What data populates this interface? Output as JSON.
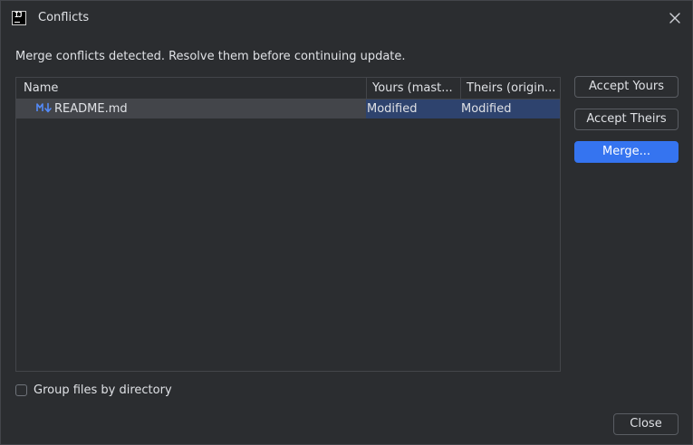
{
  "window": {
    "title": "Conflicts"
  },
  "message": "Merge conflicts detected. Resolve them before continuing update.",
  "table": {
    "columns": [
      "Name",
      "Yours (mast...",
      "Theirs (origin..."
    ],
    "rows": [
      {
        "icon": "markdown-file-icon",
        "name": "README.md",
        "yours": "Modified",
        "theirs": "Modified",
        "selected": true
      }
    ]
  },
  "actions": {
    "accept_yours": "Accept Yours",
    "accept_theirs": "Accept Theirs",
    "merge": "Merge..."
  },
  "options": {
    "group_by_directory_label": "Group files by directory",
    "group_by_directory_checked": false
  },
  "footer": {
    "close_label": "Close"
  },
  "colors": {
    "background": "#2b2d30",
    "primary_button": "#3574f0",
    "selection": "#2e436e",
    "markdown_icon": "#548af7"
  }
}
